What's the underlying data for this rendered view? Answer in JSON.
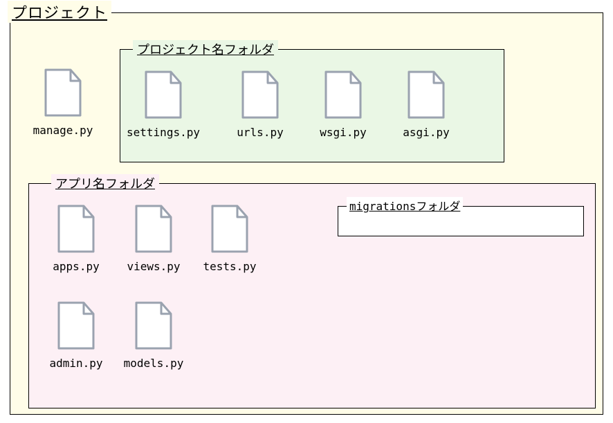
{
  "project": {
    "title": "プロジェクト",
    "root_files": [
      {
        "name": "manage.py"
      }
    ],
    "project_name_folder": {
      "title": "プロジェクト名フォルダ",
      "files": [
        {
          "name": "settings.py"
        },
        {
          "name": "urls.py"
        },
        {
          "name": "wsgi.py"
        },
        {
          "name": "asgi.py"
        }
      ]
    },
    "app_folder": {
      "title": "アプリ名フォルダ",
      "files_row1": [
        {
          "name": "apps.py"
        },
        {
          "name": "views.py"
        },
        {
          "name": "tests.py"
        }
      ],
      "files_row2": [
        {
          "name": "admin.py"
        },
        {
          "name": "models.py"
        }
      ],
      "migrations_folder": {
        "title": "migrationsフォルダ"
      }
    }
  }
}
